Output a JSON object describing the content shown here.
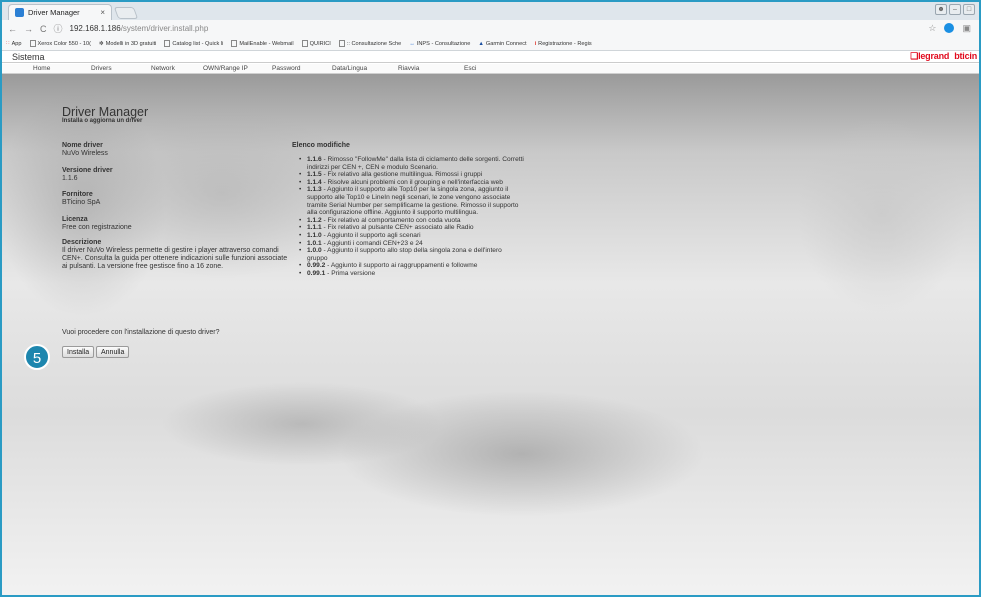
{
  "browser": {
    "tab_title": "Driver Manager",
    "tab_close": "×",
    "url_host": "192.168.1.186",
    "url_path": "/system/driver.install.php",
    "nav_back": "←",
    "nav_forward": "→",
    "nav_reload": "C",
    "info_icon": "ⓘ",
    "star": "☆"
  },
  "bookmarks": [
    {
      "label": "App"
    },
    {
      "label": "Xerox Color 550 - 10("
    },
    {
      "label": "Modelli in 3D gratuiti"
    },
    {
      "label": "Catalog list - Quick li"
    },
    {
      "label": "MailEnable - Webmail"
    },
    {
      "label": "QUIRICI"
    },
    {
      "label": ":: Consultazione Sche"
    },
    {
      "label": "INPS - Consultazione"
    },
    {
      "label": "Garmin Connect"
    },
    {
      "label": "Registrazione - Regis"
    }
  ],
  "app": {
    "section": "Sistema",
    "brand_legrand": "legrand",
    "brand_bticino": "bticin"
  },
  "nav": [
    {
      "label": "Home"
    },
    {
      "label": "Drivers"
    },
    {
      "label": "Network"
    },
    {
      "label": "OWN/Range IP"
    },
    {
      "label": "Password"
    },
    {
      "label": "Data/Lingua"
    },
    {
      "label": "Riavvia"
    },
    {
      "label": "Esci"
    }
  ],
  "page": {
    "title": "Driver Manager",
    "subtitle": "Installa o aggiorna un driver"
  },
  "driver": {
    "name_label": "Nome driver",
    "name_value": "NuVo Wireless",
    "version_label": "Versione driver",
    "version_value": "1.1.6",
    "vendor_label": "Fornitore",
    "vendor_value": "BTicino SpA",
    "license_label": "Licenza",
    "license_value": "Free con registrazione",
    "desc_label": "Descrizione",
    "desc_value": "Il driver NuVo Wireless permette di gestire i player attraverso comandi CEN+. Consulta la guida per ottenere indicazioni sulle funzioni associate ai pulsanti. La versione free gestisce fino a 16 zone."
  },
  "changes": {
    "title": "Elenco modifiche",
    "items": [
      {
        "version": "1.1.6",
        "text": " - Rimosso \"FollowMe\" dalla lista di ciclamento delle sorgenti. Corretti indirizzi per CEN +, CEN e modulo Scenario."
      },
      {
        "version": "1.1.5",
        "text": " - Fix relativo alla gestione multilingua. Rimossi i gruppi"
      },
      {
        "version": "1.1.4",
        "text": " - Risolve alcuni problemi con il grouping e nell'interfaccia web"
      },
      {
        "version": "1.1.3",
        "text": " - Aggiunto il supporto alle Top10 per la singola zona, aggiunto il supporto alle Top10 e LineIn negli scenari, le zone vengono associate tramite Serial Number per semplificarne la gestione. Rimosso il supporto alla configurazione offline. Aggiunto il supporto multilingua."
      },
      {
        "version": "1.1.2",
        "text": " - Fix relativo al comportamento con coda vuota"
      },
      {
        "version": "1.1.1",
        "text": " - Fix relativo al pulsante CEN+ associato alle Radio"
      },
      {
        "version": "1.1.0",
        "text": " - Aggiunto il supporto agli scenari"
      },
      {
        "version": "1.0.1",
        "text": " - Aggiunti i comandi CEN+23 e 24"
      },
      {
        "version": "1.0.0",
        "text": " - Aggiunto il supporto allo stop della singola zona e dell'intero gruppo"
      },
      {
        "version": "0.99.2",
        "text": " - Aggiunto il supporto ai raggruppamenti e followme"
      },
      {
        "version": "0.99.1",
        "text": " - Prima versione"
      }
    ]
  },
  "confirm": {
    "question": "Vuoi procedere con l'installazione di questo driver?",
    "install_label": "Installa",
    "cancel_label": "Annulla"
  },
  "step_badge": "5"
}
